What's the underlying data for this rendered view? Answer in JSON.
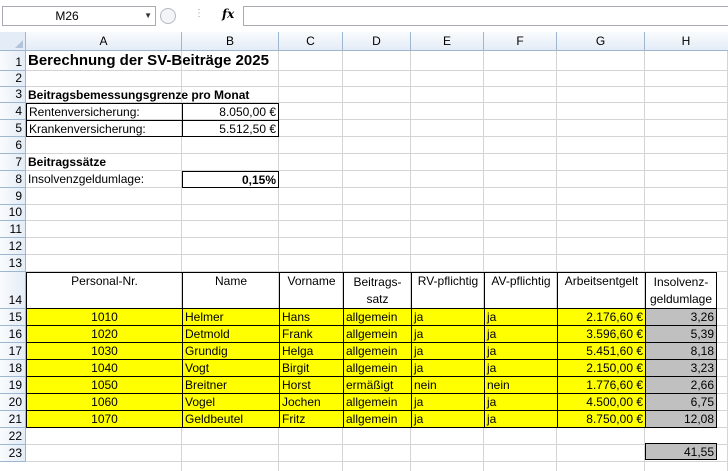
{
  "namebox": {
    "value": "M26"
  },
  "formula_bar": {
    "fx_label": "fx",
    "value": ""
  },
  "columns": [
    "A",
    "B",
    "C",
    "D",
    "E",
    "F",
    "G",
    "H"
  ],
  "rows": [
    "1",
    "2",
    "3",
    "4",
    "5",
    "6",
    "7",
    "8",
    "9",
    "10",
    "11",
    "12",
    "13",
    "14",
    "15",
    "16",
    "17",
    "18",
    "19",
    "20",
    "21",
    "22",
    "23"
  ],
  "sheet": {
    "title": "Berechnung der SV-Beiträge 2025",
    "bbg_heading": "Beitragsbemessungsgrenze pro Monat",
    "rv_label": "Rentenversicherung:",
    "rv_value": "8.050,00 €",
    "kv_label": "Krankenversicherung:",
    "kv_value": "5.512,50 €",
    "rates_heading": "Beitragssätze",
    "insolvency_label": "Insolvenzgeldumlage:",
    "insolvency_value": "0,15%",
    "total": "41,55"
  },
  "table": {
    "headers": {
      "personal_nr": "Personal-Nr.",
      "name": "Name",
      "vorname": "Vorname",
      "beitragssatz_1": "Beitrags-",
      "beitragssatz_2": "satz",
      "rv": "RV-pflichtig",
      "av": "AV-pflichtig",
      "entgelt": "Arbeitsentgelt",
      "umlage_1": "Insolvenz-",
      "umlage_2": "geldumlage"
    },
    "rows": [
      {
        "nr": "1010",
        "name": "Helmer",
        "vorname": "Hans",
        "satz": "allgemein",
        "rv": "ja",
        "av": "ja",
        "entgelt": "2.176,60 €",
        "umlage": "3,26"
      },
      {
        "nr": "1020",
        "name": "Detmold",
        "vorname": "Frank",
        "satz": "allgemein",
        "rv": "ja",
        "av": "ja",
        "entgelt": "3.596,60 €",
        "umlage": "5,39"
      },
      {
        "nr": "1030",
        "name": "Grundig",
        "vorname": "Helga",
        "satz": "allgemein",
        "rv": "ja",
        "av": "ja",
        "entgelt": "5.451,60 €",
        "umlage": "8,18"
      },
      {
        "nr": "1040",
        "name": "Vogt",
        "vorname": "Birgit",
        "satz": "allgemein",
        "rv": "ja",
        "av": "ja",
        "entgelt": "2.150,00 €",
        "umlage": "3,23"
      },
      {
        "nr": "1050",
        "name": "Breitner",
        "vorname": "Horst",
        "satz": "ermäßigt",
        "rv": "nein",
        "av": "nein",
        "entgelt": "1.776,60 €",
        "umlage": "2,66"
      },
      {
        "nr": "1060",
        "name": "Vogel",
        "vorname": "Jochen",
        "satz": "allgemein",
        "rv": "ja",
        "av": "ja",
        "entgelt": "4.500,00 €",
        "umlage": "6,75"
      },
      {
        "nr": "1070",
        "name": "Geldbeutel",
        "vorname": "Fritz",
        "satz": "allgemein",
        "rv": "ja",
        "av": "ja",
        "entgelt": "8.750,00 €",
        "umlage": "12,08"
      }
    ]
  }
}
